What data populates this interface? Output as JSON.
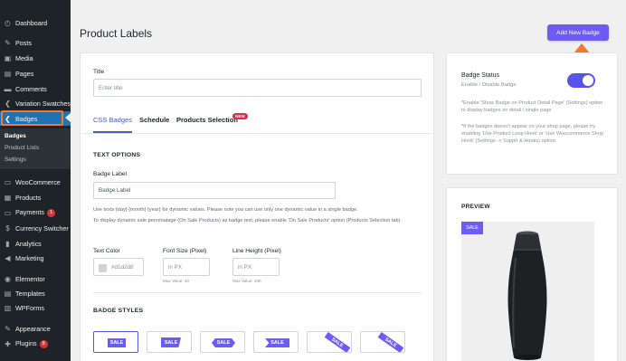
{
  "sidebar": {
    "items": [
      {
        "label": "Dashboard",
        "icon": "dashboard-icon"
      },
      {
        "label": "Posts",
        "icon": "pin-icon"
      },
      {
        "label": "Media",
        "icon": "media-icon"
      },
      {
        "label": "Pages",
        "icon": "pages-icon"
      },
      {
        "label": "Comments",
        "icon": "comment-icon"
      },
      {
        "label": "Variation Swatches",
        "icon": "swatches-icon"
      },
      {
        "label": "Badges",
        "icon": "badge-icon"
      },
      {
        "label": "WooCommerce",
        "icon": "woocommerce-icon"
      },
      {
        "label": "Products",
        "icon": "products-icon"
      },
      {
        "label": "Payments",
        "icon": "payments-icon",
        "count": "1"
      },
      {
        "label": "Currency Switcher",
        "icon": "currency-icon"
      },
      {
        "label": "Analytics",
        "icon": "analytics-icon"
      },
      {
        "label": "Marketing",
        "icon": "marketing-icon"
      },
      {
        "label": "Elementor",
        "icon": "elementor-icon"
      },
      {
        "label": "Templates",
        "icon": "templates-icon"
      },
      {
        "label": "WPForms",
        "icon": "wpforms-icon"
      },
      {
        "label": "Appearance",
        "icon": "appearance-icon"
      },
      {
        "label": "Plugins",
        "icon": "plugins-icon",
        "count": "9"
      }
    ],
    "submenu": [
      "Badges",
      "Product Lists",
      "Settings"
    ]
  },
  "header": {
    "title": "Product Labels",
    "add_button": "Add New Badge"
  },
  "form": {
    "title_label": "Title",
    "title_placeholder": "Enter title",
    "tabs": [
      "CSS Badges",
      "Schedule",
      "Products Selection"
    ],
    "new_pill": "NEW",
    "text_options": "TEXT OPTIONS",
    "badge_label": "Badge Label",
    "badge_label_value": "Badge Label",
    "help1": "Use texts {day} {month} {year} for dynamic values. Please note you can use only one dynamic value in a single badge.",
    "help2": "To display dynamic sale percenatage (On Sale Products) as badge text, please enable 'On Sale Products' option (Products Selection tab)",
    "text_color_label": "Text Color",
    "text_color_value": "#d1d2d8",
    "font_size_label": "Font Size (Pixel)",
    "font_size_placeholder": "in PX",
    "font_size_max": "Max Value: 40",
    "line_height_label": "Line Height (Pixel)",
    "line_height_placeholder": "in PX",
    "line_height_max": "Max Value: 100",
    "badge_styles": "BADGE STYLES",
    "style_labels": [
      "SALE",
      "SALE",
      "SALE",
      "SALE",
      "SALE",
      "SALE"
    ]
  },
  "status": {
    "title": "Badge Status",
    "subtitle": "Enable / Disable Badge",
    "enabled": true,
    "note1": "*Enable 'Show Badge on Product Detail Page' (Settings) option to display badges on detail / single page",
    "note2": "*If the badges doesn't appear on your shop page, please try enabling 'Use Product Loop Hook' or 'Use Woocommerce Shop Hook' (Settings -> Supprt & Hooks) option"
  },
  "preview": {
    "title": "PREVIEW",
    "sale": "SALE"
  },
  "colors": {
    "accent": "#6a5cf5",
    "sidebar_bg": "#1d2327",
    "active_menu": "#2271b1",
    "highlight_orange": "#f0782f"
  }
}
